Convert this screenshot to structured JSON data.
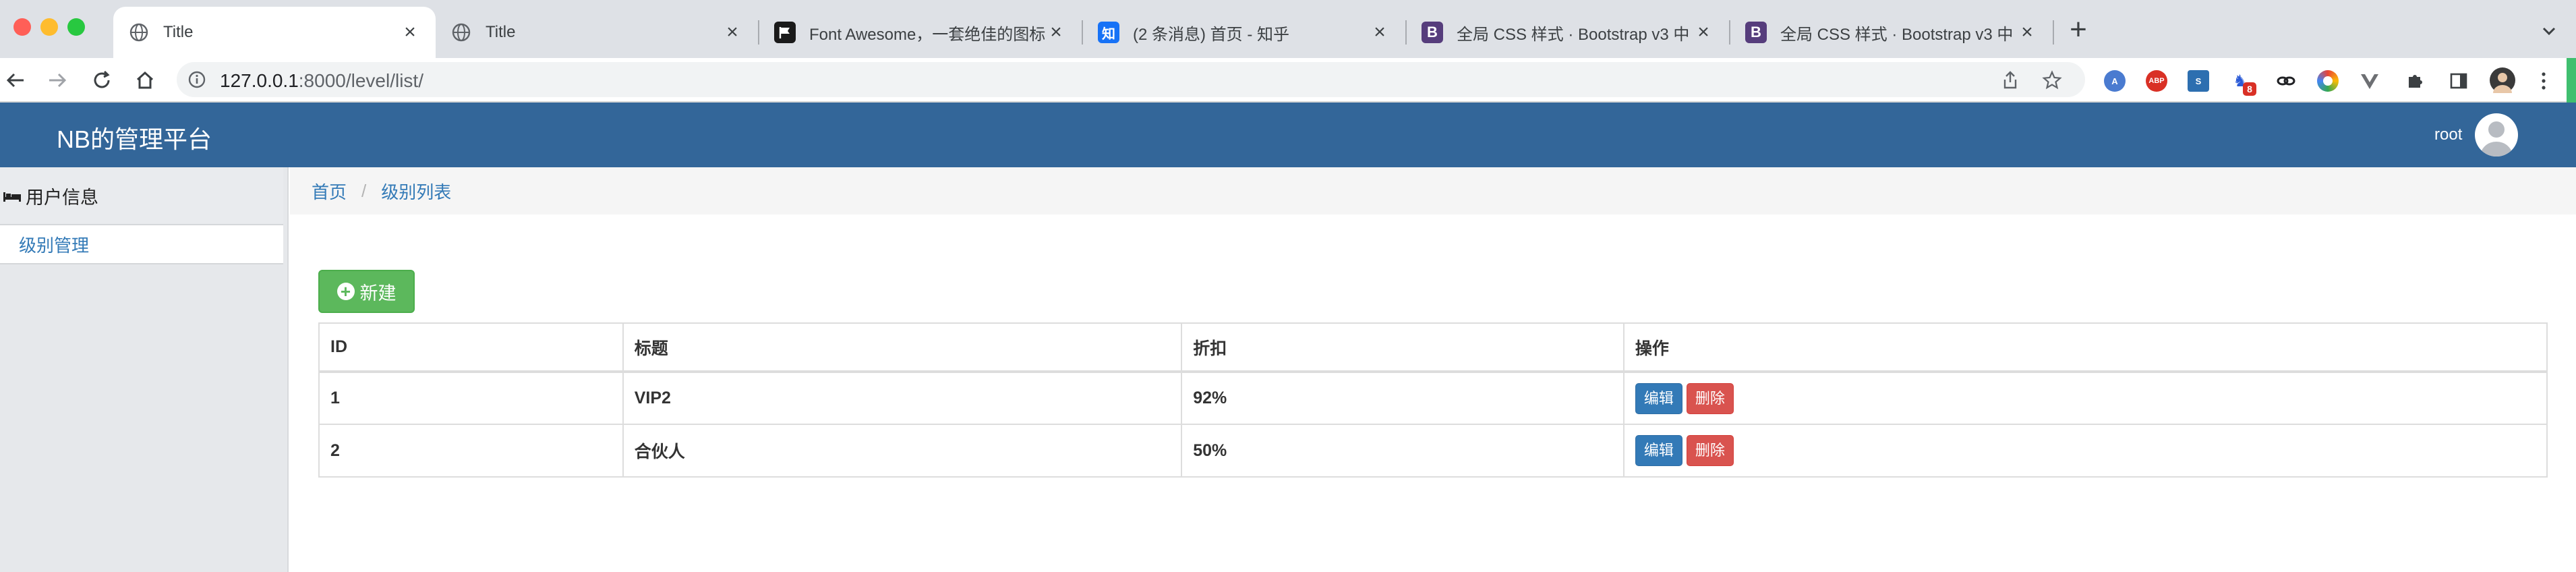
{
  "browser": {
    "tabs": [
      {
        "title": "Title",
        "favicon": "globe-icon",
        "active": true
      },
      {
        "title": "Title",
        "favicon": "globe-icon",
        "active": false
      },
      {
        "title": "Font Awesome，一套绝佳的图标",
        "favicon": "flag-icon",
        "active": false
      },
      {
        "title": "(2 条消息) 首页 - 知乎",
        "favicon": "zhihu-icon",
        "favicon_text": "知",
        "active": false
      },
      {
        "title": "全局 CSS 样式 · Bootstrap v3 中",
        "favicon": "bootstrap-icon",
        "favicon_text": "B",
        "active": false
      },
      {
        "title": "全局 CSS 样式 · Bootstrap v3 中",
        "favicon": "bootstrap-icon",
        "favicon_text": "B",
        "active": false
      }
    ],
    "url_host": "127.0.0.1",
    "url_rest": ":8000/level/list/",
    "extensions": [
      "translate-icon",
      "adblock-icon",
      "extension-icon",
      "extension-icon",
      "link-icon",
      "color-icon",
      "vue-icon",
      "puzzle-icon",
      "sidepanel-icon",
      "profile-icon",
      "menu-icon"
    ],
    "extension_labels": {
      "adblock": "ABP",
      "badge": "8"
    }
  },
  "header": {
    "brand": "NB的管理平台",
    "user": "root"
  },
  "sidebar": {
    "heading": "用户信息",
    "items": [
      {
        "label": "级别管理"
      }
    ]
  },
  "breadcrumb": {
    "home": "首页",
    "separator": "/",
    "current": "级别列表"
  },
  "actions": {
    "new_label": "新建"
  },
  "table": {
    "columns": [
      "ID",
      "标题",
      "折扣",
      "操作"
    ],
    "rows": [
      {
        "id": "1",
        "title": "VIP2",
        "discount": "92%"
      },
      {
        "id": "2",
        "title": "合伙人",
        "discount": "50%"
      }
    ],
    "edit_label": "编辑",
    "delete_label": "删除"
  },
  "colors": {
    "header_bg": "#336699",
    "success": "#5cb85c",
    "primary": "#337ab7",
    "danger": "#d9534f",
    "link": "#337ab7"
  }
}
